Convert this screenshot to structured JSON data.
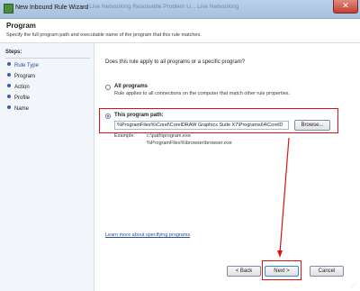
{
  "window": {
    "title": "New Inbound Rule Wizard",
    "background_tabs": "...  Live Networking   Resolvable Problem U...   Live Networking",
    "close_symbol": "✕"
  },
  "header": {
    "title": "Program",
    "description": "Specify the full program path and executable name of the program that this rule matches."
  },
  "steps": {
    "heading": "Steps:",
    "items": [
      {
        "label": "Rule Type",
        "state": "link"
      },
      {
        "label": "Program",
        "state": "current"
      },
      {
        "label": "Action",
        "state": "normal"
      },
      {
        "label": "Profile",
        "state": "normal"
      },
      {
        "label": "Name",
        "state": "normal"
      }
    ]
  },
  "main": {
    "question": "Does this rule apply to all programs or a specific program?",
    "all_programs": {
      "label": "All programs",
      "description": "Rule applies to all connections on the computer that match other rule properties.",
      "checked": false
    },
    "program_path": {
      "label": "This program path:",
      "value": "%ProgramFiles%\\Corel\\CorelDRAW Graphics Suite X7\\Programs64\\CorelD",
      "browse_label": "Browse...",
      "checked": true
    },
    "example": {
      "label": "Example:",
      "line1": "c:\\path\\program.exe",
      "line2": "%ProgramFiles%\\browser\\browser.exe"
    },
    "learn_link": "Learn more about specifying programs"
  },
  "buttons": {
    "back": "< Back",
    "next": "Next >",
    "cancel": "Cancel"
  },
  "colors": {
    "annotation": "#e01010",
    "link": "#2a4fa0"
  }
}
